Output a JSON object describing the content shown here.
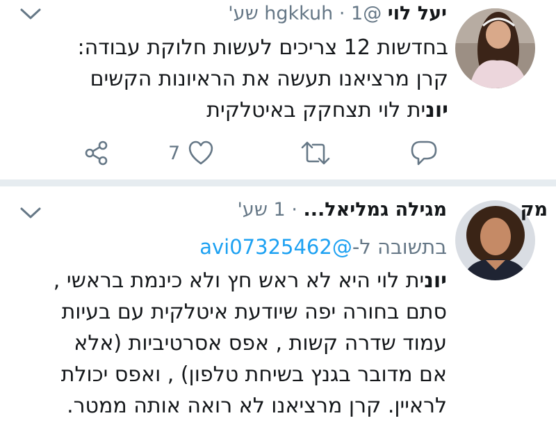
{
  "tweets": [
    {
      "display_name": "יעל לוי",
      "handle": "@hgkkuh",
      "separator": "·",
      "time": "1 שע'",
      "lines": [
        "בחדשות 12 צריכים לעשות חלוקת עבודה:",
        "קרן מרציאנו תעשה את הראיונות הקשים"
      ],
      "last_line_highlight": "יונ",
      "last_line_rest": "ית לוי תצחקק באיטלקית",
      "actions": {
        "reply_count": "",
        "retweet_count": "",
        "like_count": "7"
      }
    },
    {
      "display_name_prefix": "מק",
      "display_name": "מגילה גמליאל...",
      "separator": "·",
      "time": "1 שע'",
      "reply_prefix": "בתשובה ל-",
      "reply_handle": "@avi07325462",
      "first_line_highlight": "יונ",
      "first_line_rest": "ית לוי היא לא ראש חץ ולא כינמת בראשי ,",
      "lines": [
        "סתם בחורה יפה שיודעת איטלקית עם בעיות",
        "עמוד שדרה קשות , אפס אסרטיביות (אלא",
        "אם מדובר בגנץ בשיחת טלפון) , ואפס יכולת",
        "לראיין. קרן מרציאנו לא רואה אותה ממטר."
      ]
    }
  ],
  "icons": {
    "reply": "reply-icon",
    "retweet": "retweet-icon",
    "like": "heart-icon",
    "share": "share-icon",
    "caret": "chevron-down-icon"
  },
  "colors": {
    "text": "#14171a",
    "muted": "#657786",
    "link": "#1da1f2",
    "divider": "#e6ecf0"
  }
}
